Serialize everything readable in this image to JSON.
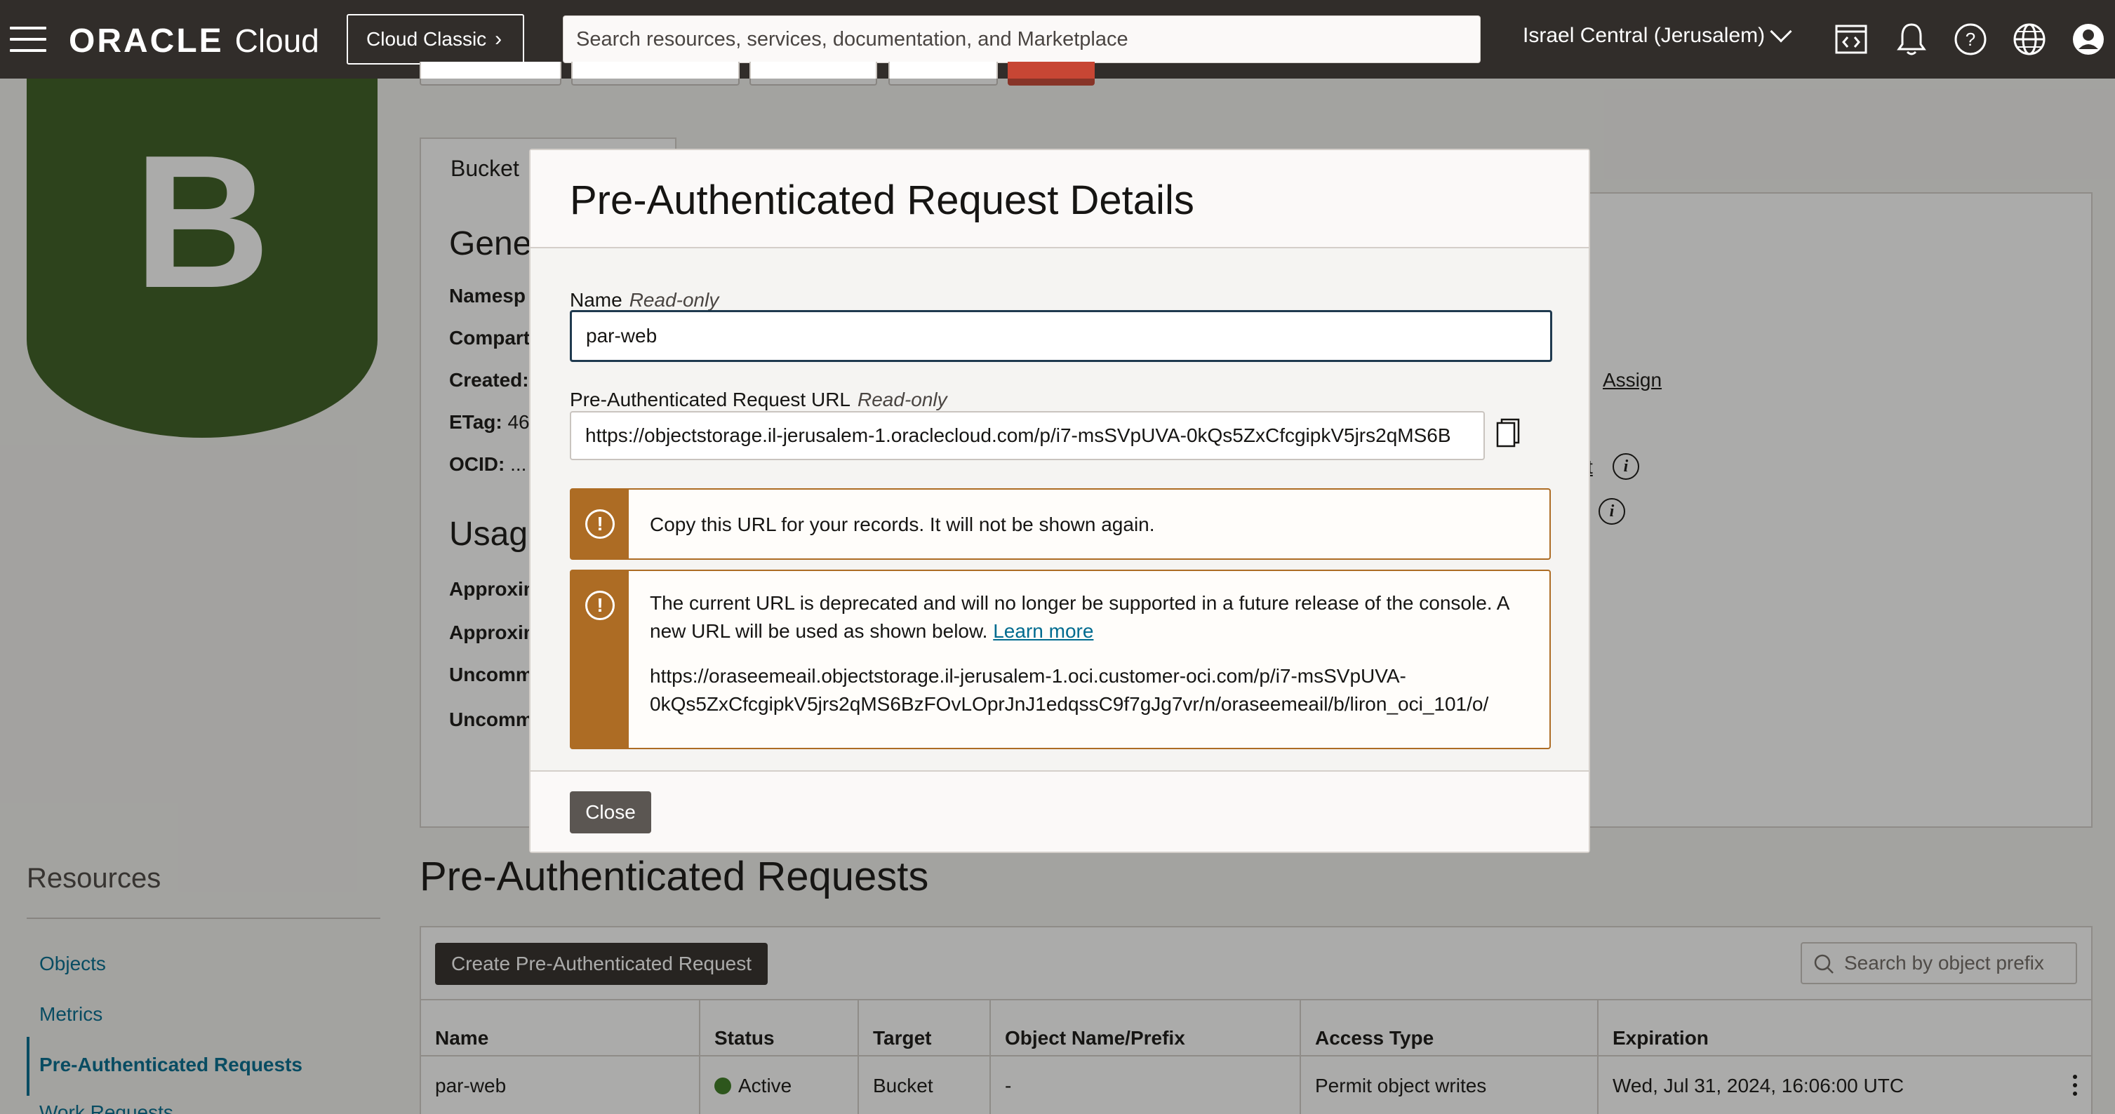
{
  "header": {
    "brand_oracle": "ORACLE",
    "brand_cloud": "Cloud",
    "classic_button": "Cloud Classic",
    "search_placeholder": "Search resources, services, documentation, and Marketplace",
    "region": "Israel Central (Jerusalem)",
    "icons": [
      "code-editor-icon",
      "bell-icon",
      "help-icon",
      "globe-icon",
      "profile-icon"
    ]
  },
  "bucket": {
    "logo_letter": "B",
    "tab_label": "Bucket",
    "general_heading": "Gene",
    "usage_heading": "Usag",
    "fields": [
      {
        "label": "Namesp",
        "value": ""
      },
      {
        "label": "Compart",
        "value": ""
      },
      {
        "label": "Created:",
        "value": ""
      },
      {
        "label": "ETag:",
        "value": " 46"
      },
      {
        "label": "OCID:",
        "value": " ..."
      }
    ],
    "usage_fields": [
      "Approxim",
      "Approxim",
      "Uncomm",
      "Uncomm"
    ],
    "assign_link": "Assign",
    "link_fragment": "t"
  },
  "resources": {
    "title": "Resources",
    "items": [
      {
        "label": "Objects"
      },
      {
        "label": "Metrics"
      },
      {
        "label": "Pre-Authenticated Requests"
      },
      {
        "label": "Work Requests"
      }
    ]
  },
  "par_section": {
    "heading": "Pre-Authenticated Requests",
    "create_button": "Create Pre-Authenticated Request",
    "search_placeholder": "Search by object prefix",
    "columns": [
      "Name",
      "Status",
      "Target",
      "Object Name/Prefix",
      "Access Type",
      "Expiration"
    ],
    "rows": [
      {
        "name": "par-web",
        "status": "Active",
        "target": "Bucket",
        "object_prefix": "-",
        "access_type": "Permit object writes",
        "expiration": "Wed, Jul 31, 2024, 16:06:00 UTC"
      }
    ]
  },
  "modal": {
    "title": "Pre-Authenticated Request Details",
    "name_label": "Name",
    "readonly_tag": "Read-only",
    "name_value": "par-web",
    "url_label": "Pre-Authenticated Request URL",
    "url_value": "https://objectstorage.il-jerusalem-1.oraclecloud.com/p/i7-msSVpUVA-0kQs5ZxCfcgipkV5jrs2qMS6B",
    "notice1": "Copy this URL for your records. It will not be shown again.",
    "notice2_line1": "The current URL is deprecated and will no longer be supported in a future release of the console. A",
    "notice2_line2": "new URL will be used as shown below.",
    "learn_more": "Learn more",
    "new_url_line1": "https://oraseemeail.objectstorage.il-jerusalem-1.oci.customer-oci.com/p/i7-msSVpUVA-",
    "new_url_line2": "0kQs5ZxCfcgipkV5jrs2qMS6BzFOvLOprJnJ1edqssC9f7gJg7vr/n/oraseemeail/b/liron_oci_101/o/",
    "close_button": "Close"
  }
}
